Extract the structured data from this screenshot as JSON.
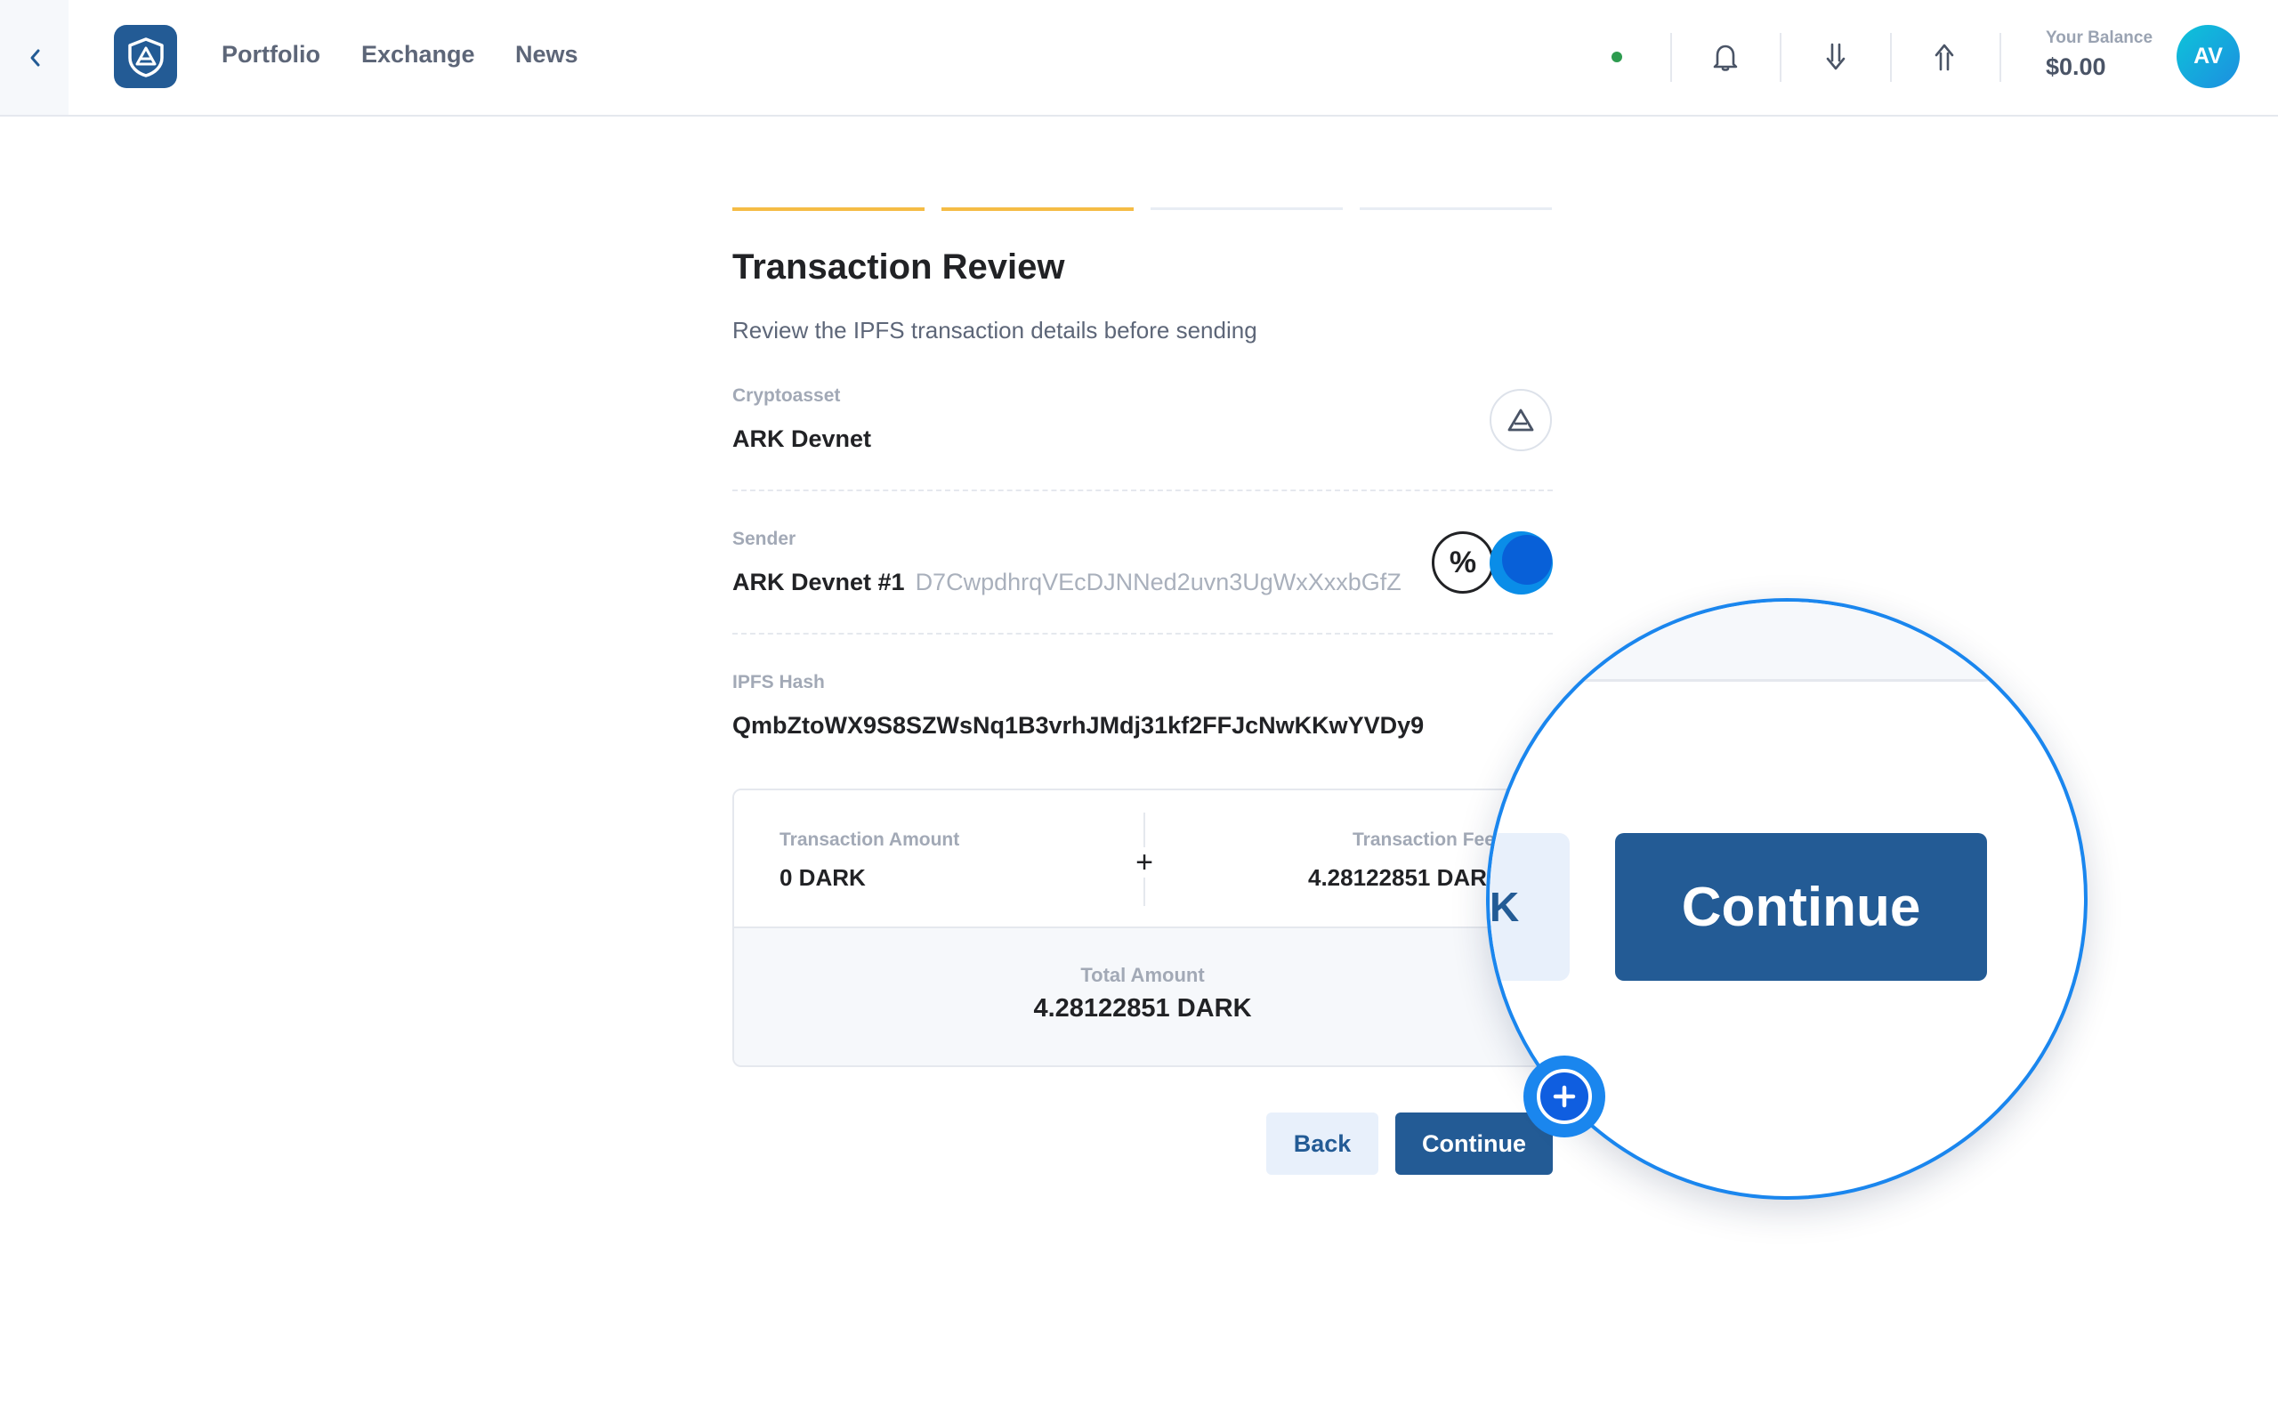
{
  "header": {
    "nav": [
      {
        "label": "Portfolio"
      },
      {
        "label": "Exchange"
      },
      {
        "label": "News"
      }
    ],
    "balance_label": "Your Balance",
    "balance_value": "$0.00",
    "avatar_initials": "AV",
    "icons": [
      "chevron-left-icon",
      "ark-logo-icon",
      "bell-icon",
      "receive-icon",
      "send-icon"
    ],
    "status_color": "#2d9b4f"
  },
  "stepper": {
    "total_steps": 4,
    "completed_steps": 2,
    "active_color": "#f5bc45"
  },
  "review": {
    "title": "Transaction Review",
    "subtitle": "Review the IPFS transaction details before sending",
    "cryptoasset_label": "Cryptoasset",
    "cryptoasset_value": "ARK Devnet",
    "sender_label": "Sender",
    "sender_name": "ARK Devnet #1",
    "sender_address": "D7CwpdhrqVEcDJNNed2uvn3UgWxXxxbGfZ",
    "ipfs_label": "IPFS Hash",
    "ipfs_value": "QmbZtoWX9S8SZWsNq1B3vrhJMdj31kf2FFJcNwKKwYVDy9"
  },
  "summary": {
    "amount_label": "Transaction Amount",
    "amount_value": "0 DARK",
    "fee_label": "Transaction Fee",
    "fee_value": "4.28122851 DARK",
    "total_label": "Total Amount",
    "total_value": "4.28122851 DARK"
  },
  "actions": {
    "back_label": "Back",
    "continue_label": "Continue"
  },
  "magnifier": {
    "back_fragment": "K",
    "continue_label": "Continue"
  },
  "colors": {
    "primary": "#235b95",
    "accent_blue": "#1a86ee"
  }
}
